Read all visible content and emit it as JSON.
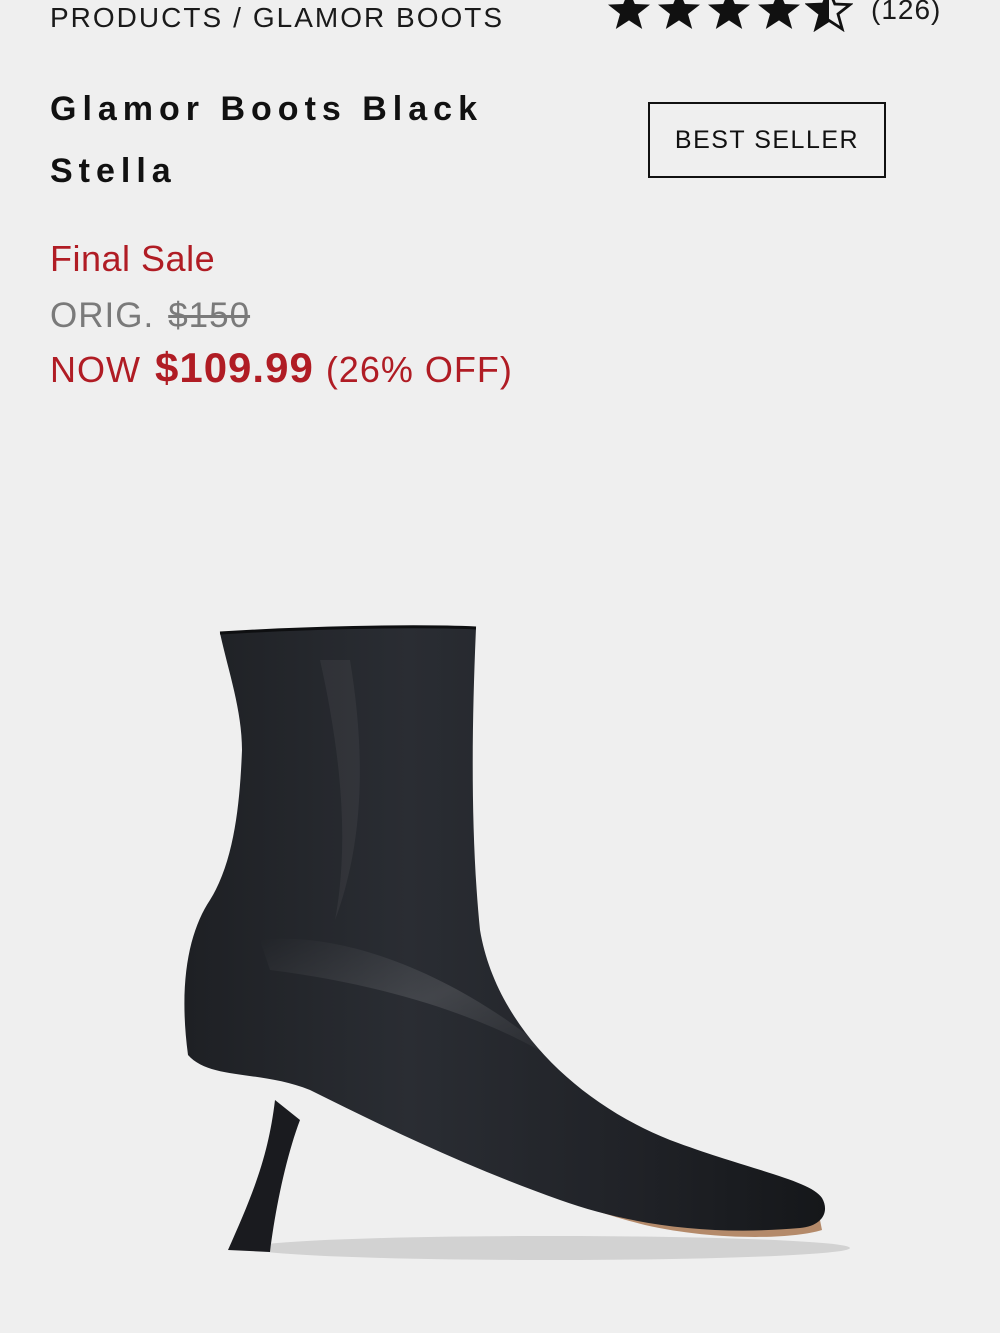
{
  "breadcrumb": {
    "parent": "PRODUCTS",
    "separator": "/",
    "current": "GLAMOR BOOTS"
  },
  "rating": {
    "stars": 4.5,
    "max_stars": 5,
    "review_count": "(126)"
  },
  "product": {
    "title_line1": "Glamor Boots Black",
    "title_line2": "Stella",
    "badge": "BEST SELLER",
    "sale_label": "Final Sale",
    "orig_label": "ORIG.",
    "orig_price": "$150",
    "now_label": "NOW",
    "now_price": "$109.99",
    "discount": "(26% OFF)",
    "image_icon": "black-ankle-boot-image"
  },
  "colors": {
    "sale_red": "#b01c24",
    "background": "#efefef",
    "text": "#111111",
    "muted": "#7a7a7a"
  }
}
